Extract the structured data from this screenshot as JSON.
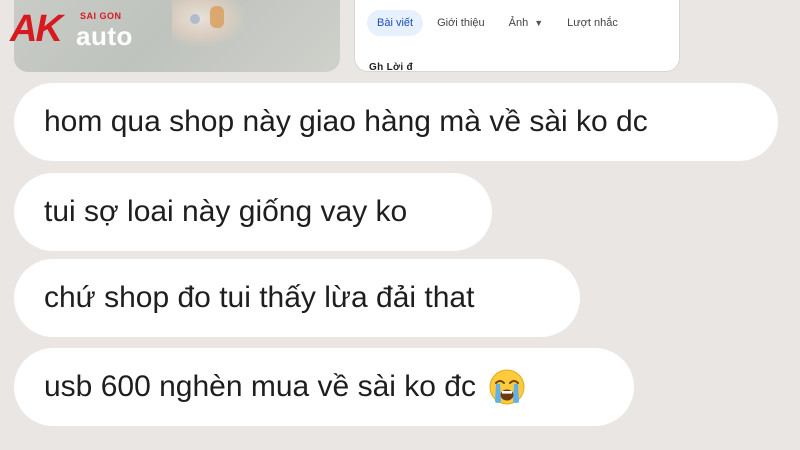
{
  "logo": {
    "ak": "AK",
    "saigon": "SAI GON",
    "auto": "auto"
  },
  "facebook_card": {
    "tabs": [
      {
        "label": "Bài viết",
        "active": true
      },
      {
        "label": "Giới thiệu",
        "active": false
      },
      {
        "label": "Ảnh",
        "active": false,
        "dropdown": true
      },
      {
        "label": "Lượt nhắc",
        "active": false
      }
    ],
    "cut_text": "Gh Lời đ"
  },
  "messages": [
    {
      "text": "hom qua shop này giao hàng mà về sài ko dc"
    },
    {
      "text": "tui sợ loai này giống vay ko"
    },
    {
      "text": "chứ shop đo tui thấy lừa đải that"
    },
    {
      "text": "usb 600 nghèn mua về sài ko đc",
      "emoji": "loudly-crying-face-icon"
    }
  ],
  "colors": {
    "background": "#e9e6e3",
    "bubble": "#ffffff",
    "text": "#1e1e1e",
    "brand_red": "#d71920",
    "active_tab_bg": "#e7f0fd",
    "active_tab_text": "#1c4fb7"
  }
}
